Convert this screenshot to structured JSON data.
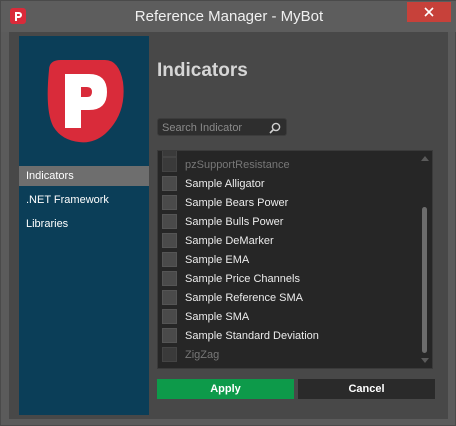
{
  "window": {
    "title": "Reference Manager - MyBot"
  },
  "sidebar": {
    "items": [
      {
        "label": "Indicators",
        "active": true
      },
      {
        "label": ".NET Framework",
        "active": false
      },
      {
        "label": "Libraries",
        "active": false
      }
    ]
  },
  "main": {
    "title": "Indicators",
    "search": {
      "placeholder": "Search Indicator",
      "value": ""
    },
    "list": {
      "items": [
        {
          "label": "pzSupportResistance",
          "checked": false,
          "faded": true
        },
        {
          "label": "Sample Alligator",
          "checked": false,
          "faded": false
        },
        {
          "label": "Sample Bears Power",
          "checked": false,
          "faded": false
        },
        {
          "label": "Sample Bulls Power",
          "checked": false,
          "faded": false
        },
        {
          "label": "Sample DeMarker",
          "checked": false,
          "faded": false
        },
        {
          "label": "Sample EMA",
          "checked": false,
          "faded": false
        },
        {
          "label": "Sample Price Channels",
          "checked": false,
          "faded": false
        },
        {
          "label": "Sample Reference SMA",
          "checked": false,
          "faded": false
        },
        {
          "label": "Sample SMA",
          "checked": false,
          "faded": false
        },
        {
          "label": "Sample Standard Deviation",
          "checked": false,
          "faded": false
        },
        {
          "label": "ZigZag",
          "checked": false,
          "faded": true
        }
      ]
    },
    "apply_label": "Apply",
    "cancel_label": "Cancel"
  },
  "colors": {
    "brand_red": "#d92b3a",
    "sidebar_bg": "#0b3e58",
    "apply_green": "#0d9a4a",
    "close_red": "#c7413a"
  },
  "icons": {
    "app": "ctrader-logo-icon",
    "close": "close-icon",
    "search": "search-icon",
    "scroll_up": "scroll-up-icon",
    "scroll_down": "scroll-down-icon"
  }
}
